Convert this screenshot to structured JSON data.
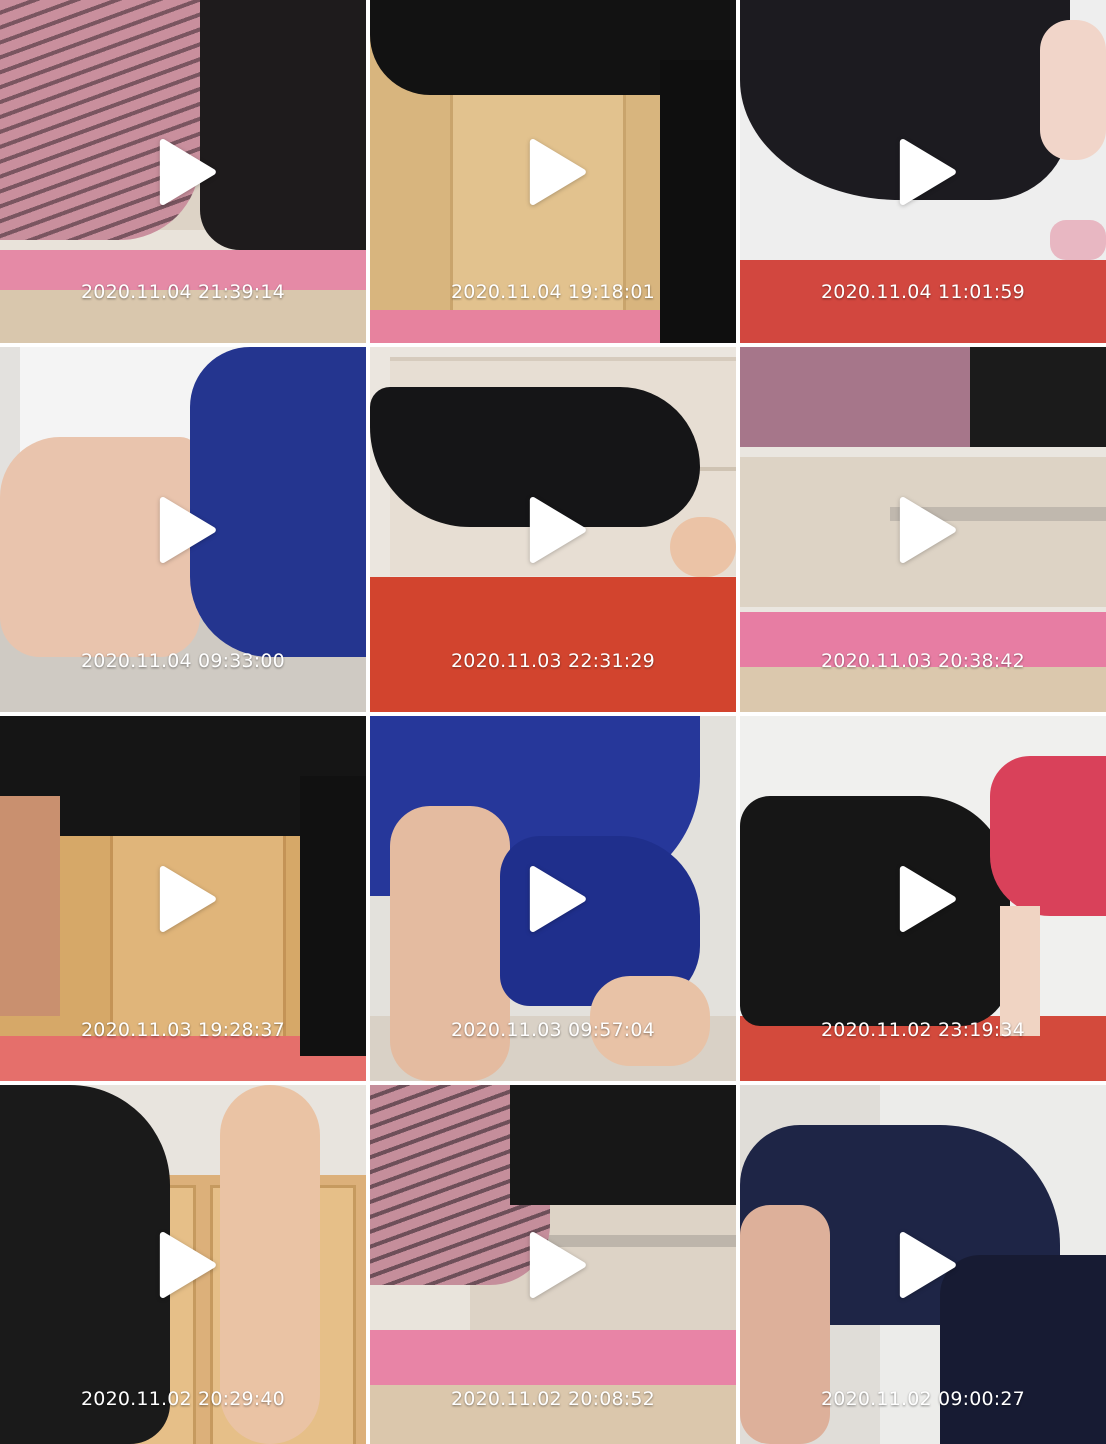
{
  "videos": [
    {
      "timestamp": "2020.11.04 21:39:14"
    },
    {
      "timestamp": "2020.11.04 19:18:01"
    },
    {
      "timestamp": "2020.11.04 11:01:59"
    },
    {
      "timestamp": "2020.11.04 09:33:00"
    },
    {
      "timestamp": "2020.11.03 22:31:29"
    },
    {
      "timestamp": "2020.11.03 20:38:42"
    },
    {
      "timestamp": "2020.11.03 19:28:37"
    },
    {
      "timestamp": "2020.11.03 09:57:04"
    },
    {
      "timestamp": "2020.11.02 23:19:34"
    },
    {
      "timestamp": "2020.11.02 20:29:40"
    },
    {
      "timestamp": "2020.11.02 20:08:52"
    },
    {
      "timestamp": "2020.11.02 09:00:27"
    }
  ],
  "icons": {
    "play": "play-icon"
  }
}
